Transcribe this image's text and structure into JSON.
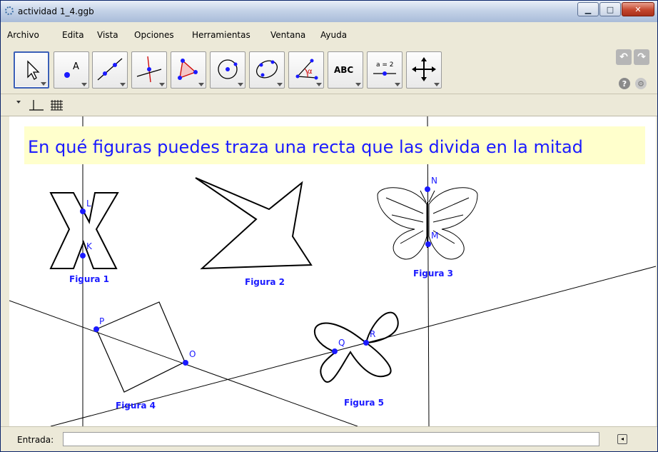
{
  "window": {
    "title": "actividad 1_4.ggb",
    "controls": [
      "minimize",
      "maximize",
      "close"
    ]
  },
  "menu": {
    "items": [
      "Archivo",
      "Edita",
      "Vista",
      "Opciones",
      "Herramientas",
      "Ventana",
      "Ayuda"
    ]
  },
  "toolbar": {
    "tools": [
      {
        "name": "move-tool",
        "selected": true
      },
      {
        "name": "point-tool",
        "glyph_text": "A"
      },
      {
        "name": "line-tool"
      },
      {
        "name": "perpendicular-line-tool"
      },
      {
        "name": "polygon-tool"
      },
      {
        "name": "circle-tool"
      },
      {
        "name": "conic-tool"
      },
      {
        "name": "angle-tool",
        "glyph_text": "α"
      },
      {
        "name": "text-tool",
        "glyph_text": "ABC"
      },
      {
        "name": "slider-tool",
        "glyph_text": "a = 2"
      },
      {
        "name": "move-graphics-tool"
      }
    ]
  },
  "style_bar": {
    "icons": [
      "axes-icon",
      "grid-icon"
    ]
  },
  "graphics": {
    "heading": "En qué figuras puedes traza una recta que las divida en la mitad",
    "heading_bg": "#ffffcc",
    "heading_color": "#1a1aff",
    "figure_labels": [
      "Figura 1",
      "Figura 2",
      "Figura 3",
      "Figura 4",
      "Figura 5"
    ],
    "points": [
      "L",
      "K",
      "N",
      "M",
      "P",
      "O",
      "Q",
      "R"
    ],
    "point_color": "#1a1aff"
  },
  "input_bar": {
    "label": "Entrada:",
    "value": ""
  }
}
